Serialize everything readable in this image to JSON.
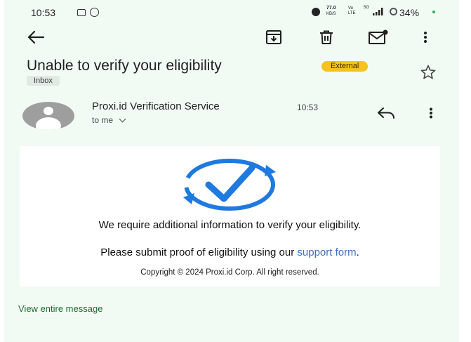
{
  "status_bar": {
    "time": "10:53",
    "net_speed": "77.0",
    "net_unit": "KB/S",
    "volte": "Vo LTE",
    "network": "5G",
    "battery": "34%"
  },
  "toolbar": {
    "back_icon": "arrow-left-icon",
    "archive_icon": "archive-icon",
    "delete_icon": "trash-icon",
    "mark_unread_icon": "mail-unread-icon",
    "more_icon": "more-vert-icon"
  },
  "email": {
    "subject": "Unable to verify your eligibility",
    "badge": "External",
    "label": "Inbox",
    "sender": "Proxi.id Verification Service",
    "time": "10:53",
    "recipient": "to me",
    "body": {
      "line1": "We require additional information to verify your eligibility.",
      "line2_prefix": "Please submit proof of eligibility using our",
      "line2_link": "support form",
      "line2_suffix": ".",
      "copyright": "Copyright © 2024 Proxi.id Corp. All right reserved."
    },
    "view_entire": "View entire message"
  },
  "colors": {
    "background": "#f2fbf3",
    "badge": "#f6c21b",
    "logo_blue": "#1f7ae0",
    "link": "#3a6fc4",
    "view_entire": "#1d6b36"
  }
}
